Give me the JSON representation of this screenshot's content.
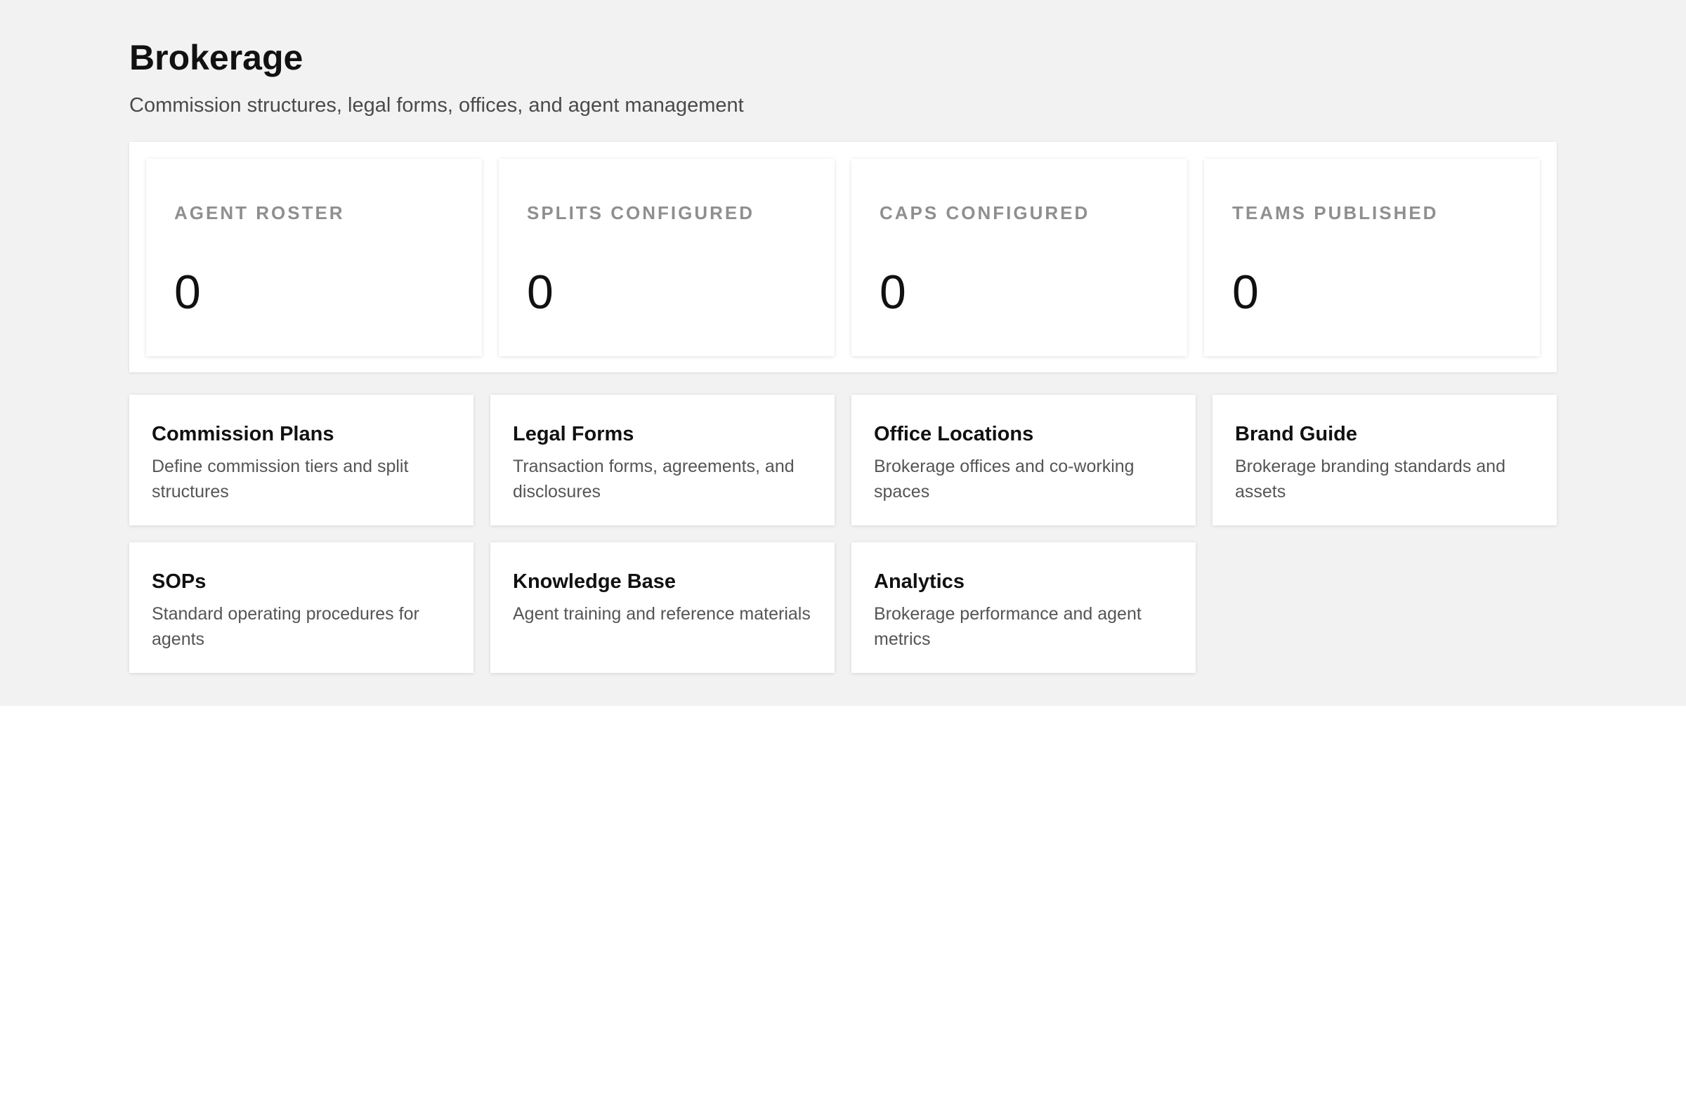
{
  "header": {
    "title": "Brokerage",
    "subtitle": "Commission structures, legal forms, offices, and agent management"
  },
  "stats": [
    {
      "label": "AGENT ROSTER",
      "value": "0"
    },
    {
      "label": "SPLITS CONFIGURED",
      "value": "0"
    },
    {
      "label": "CAPS CONFIGURED",
      "value": "0"
    },
    {
      "label": "TEAMS PUBLISHED",
      "value": "0"
    }
  ],
  "cards": [
    {
      "title": "Commission Plans",
      "description": "Define commission tiers and split structures"
    },
    {
      "title": "Legal Forms",
      "description": "Transaction forms, agreements, and disclosures"
    },
    {
      "title": "Office Locations",
      "description": "Brokerage offices and co-working spaces"
    },
    {
      "title": "Brand Guide",
      "description": "Brokerage branding standards and assets"
    },
    {
      "title": "SOPs",
      "description": "Standard operating procedures for agents"
    },
    {
      "title": "Knowledge Base",
      "description": "Agent training and reference materials"
    },
    {
      "title": "Analytics",
      "description": "Brokerage performance and agent metrics"
    }
  ]
}
